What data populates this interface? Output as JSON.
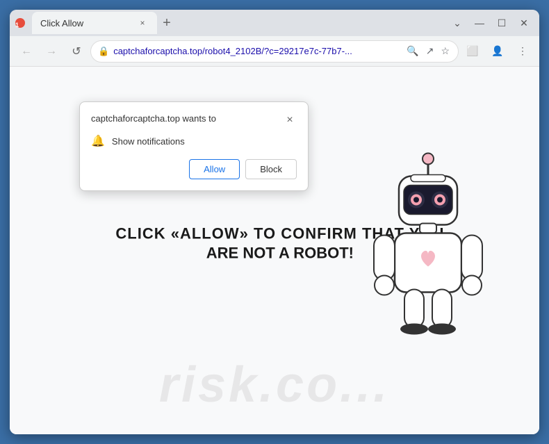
{
  "window": {
    "title": "Click Allow",
    "favicon_label": "1"
  },
  "tab": {
    "label": "Click Allow",
    "close_label": "×",
    "new_tab_label": "+"
  },
  "window_controls": {
    "minimize": "—",
    "maximize": "☐",
    "close": "✕",
    "chevron_up": "⌄",
    "menu": "⋮"
  },
  "nav": {
    "back": "←",
    "forward": "→",
    "refresh": "↺",
    "url": "captchaforcaptcha.top/robot4_2102B/?c=29217e7c-77b7-...",
    "lock_icon": "🔒",
    "search_icon": "🔍",
    "share_icon": "↗",
    "star_icon": "☆",
    "tablet_icon": "⬜",
    "account_icon": "👤"
  },
  "popup": {
    "title": "captchaforcaptcha.top wants to",
    "close_label": "×",
    "notification_text": "Show notifications",
    "allow_label": "Allow",
    "block_label": "Block"
  },
  "page": {
    "captcha_line1": "CLICK «ALLOW» TO CONFIRM THAT YOU",
    "captcha_line2": "ARE NOT A ROBOT!",
    "watermark": "risk.co..."
  }
}
